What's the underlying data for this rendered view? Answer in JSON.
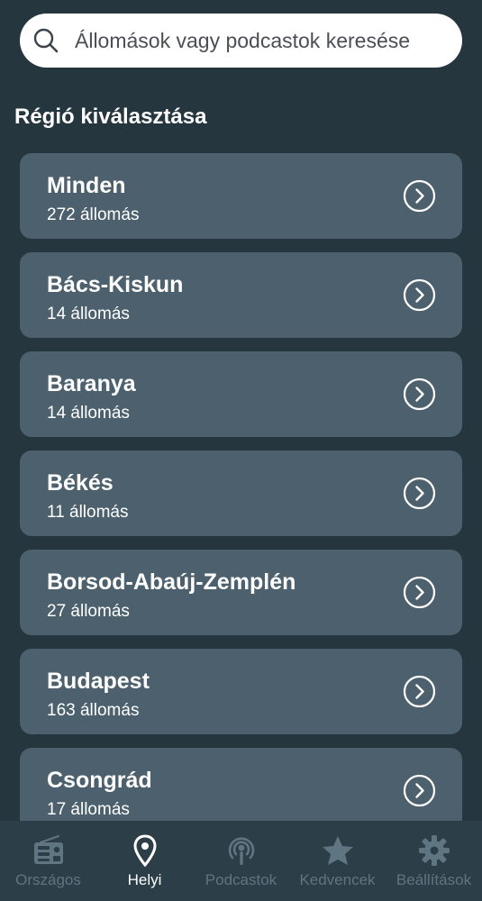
{
  "search": {
    "placeholder": "Állomások vagy podcastok keresése",
    "icon": "search-icon"
  },
  "section": {
    "title": "Régió kiválasztása"
  },
  "regions": [
    {
      "name": "Minden",
      "count": "272 állomás"
    },
    {
      "name": "Bács-Kiskun",
      "count": "14 állomás"
    },
    {
      "name": "Baranya",
      "count": "14 állomás"
    },
    {
      "name": "Békés",
      "count": "11 állomás"
    },
    {
      "name": "Borsod-Abaúj-Zemplén",
      "count": "27 állomás"
    },
    {
      "name": "Budapest",
      "count": "163 állomás"
    },
    {
      "name": "Csongrád",
      "count": "17 állomás"
    }
  ],
  "tabs": [
    {
      "label": "Országos",
      "icon": "radio-icon",
      "active": false
    },
    {
      "label": "Helyi",
      "icon": "location-pin-icon",
      "active": true
    },
    {
      "label": "Podcastok",
      "icon": "podcast-icon",
      "active": false
    },
    {
      "label": "Kedvencek",
      "icon": "star-icon",
      "active": false
    },
    {
      "label": "Beállítások",
      "icon": "gear-icon",
      "active": false
    }
  ],
  "colors": {
    "background": "#25363f",
    "card": "#4c616d",
    "tab_bar": "#2c3e48",
    "tab_inactive": "#5f7581",
    "tab_active": "#ffffff"
  }
}
